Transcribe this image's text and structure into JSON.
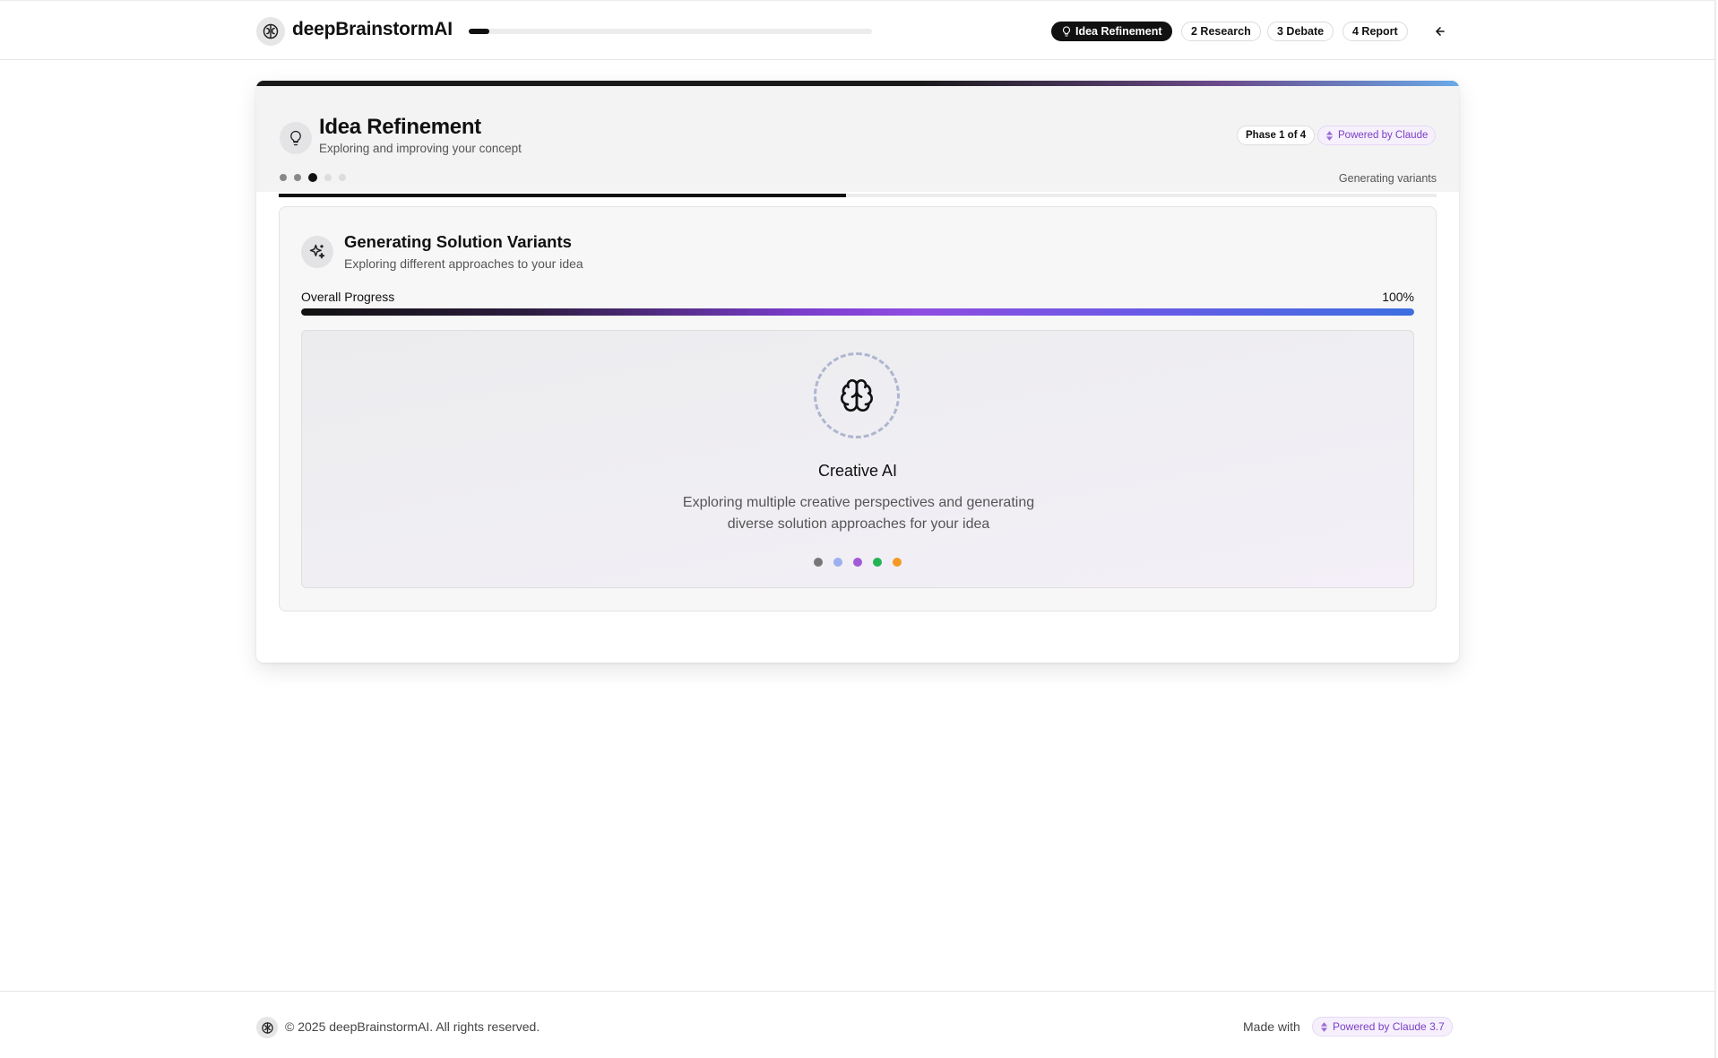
{
  "header": {
    "brand_name": "deepBrainstormAI",
    "brand_icon": "brain-icon",
    "top_progress_percent": 5,
    "nav": [
      {
        "label": "Idea Refinement",
        "active": true,
        "icon": "lightbulb-icon"
      },
      {
        "label": "2 Research",
        "active": false
      },
      {
        "label": "3 Debate",
        "active": false
      },
      {
        "label": "4 Report",
        "active": false
      }
    ],
    "back_icon": "arrow-left-icon"
  },
  "phase": {
    "title": "Idea Refinement",
    "subtitle": "Exploring and improving your concept",
    "icon": "lightbulb-icon",
    "badge": "Phase 1 of 4",
    "powered_by": "Powered by Claude",
    "step_status": "Generating variants",
    "steps": {
      "total": 5,
      "current": 3
    },
    "progress_percent": 60
  },
  "variants": {
    "title": "Generating Solution Variants",
    "subtitle": "Exploring different approaches to your idea",
    "icon": "sparkles-icon",
    "progress_label": "Overall Progress",
    "progress_value": "100%",
    "progress_percent": 100
  },
  "ai": {
    "icon": "brain-icon",
    "title": "Creative AI",
    "description": "Exploring multiple creative perspectives and generating diverse solution approaches for your idea",
    "dot_colors": [
      "#777777",
      "#9bb0ef",
      "#a15ad8",
      "#22b455",
      "#f49a24"
    ]
  },
  "footer": {
    "copyright": "© 2025 deepBrainstormAI. All rights reserved.",
    "made_with": "Made with",
    "powered_by": "Powered by Claude 3.7"
  },
  "colors": {
    "accent_purple": "#7b3fc4",
    "dark": "#111111"
  }
}
